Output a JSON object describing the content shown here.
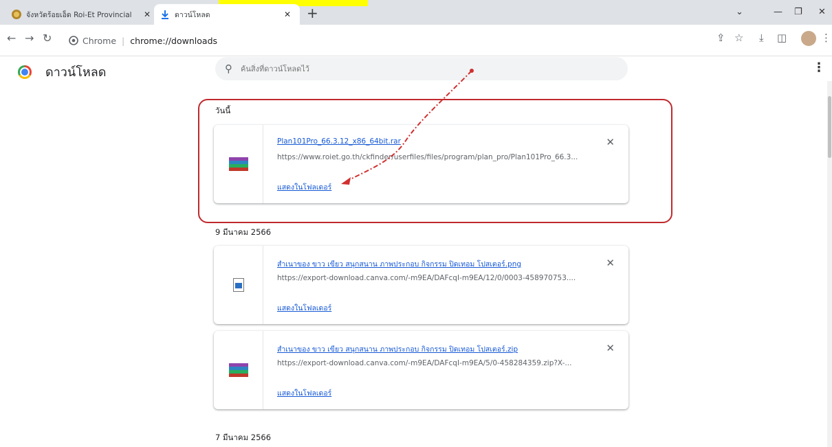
{
  "tabs": [
    {
      "title": "จังหวัดร้อยเอ็ด Roi-Et Provincial",
      "active": false,
      "favicon": "province-seal-icon"
    },
    {
      "title": "ดาวน์โหลด",
      "active": true,
      "favicon": "download-icon"
    }
  ],
  "toolbar": {
    "url_scheme_label": "Chrome",
    "url": "chrome://downloads"
  },
  "page": {
    "title": "ดาวน์โหลด",
    "search_placeholder": "ค้นสิ่งที่ดาวน์โหลดไว้"
  },
  "groups": [
    {
      "date": "วันนี้",
      "items": [
        {
          "name": "Plan101Pro_66.3.12_x86_64bit.rar",
          "url": "https://www.roiet.go.th/ckfinder/userfiles/files/program/plan_pro/Plan101Pro_66.3...",
          "action": "แสดงในโฟลเดอร์",
          "icon": "rar-file-icon"
        }
      ]
    },
    {
      "date": "9 มีนาคม 2566",
      "items": [
        {
          "name": "สำเนาของ ขาว เขียว สนุกสนาน ภาพประกอบ กิจกรรม ปิดเทอม โปสเตอร์.png",
          "url": "https://export-download.canva.com/-m9EA/DAFcqI-m9EA/12/0/0003-458970753....",
          "action": "แสดงในโฟลเดอร์",
          "icon": "image-file-icon"
        },
        {
          "name": "สำเนาของ ขาว เขียว สนุกสนาน ภาพประกอบ กิจกรรม ปิดเทอม โปสเตอร์.zip",
          "url": "https://export-download.canva.com/-m9EA/DAFcqI-m9EA/5/0-458284359.zip?X-...",
          "action": "แสดงในโฟลเดอร์",
          "icon": "rar-file-icon"
        }
      ]
    },
    {
      "date": "7 มีนาคม 2566",
      "items": []
    }
  ],
  "colors": {
    "link": "#1558d6",
    "highlight": "#c0282d",
    "annotation": "#d03030",
    "tabstrip": "#dee1e6"
  }
}
